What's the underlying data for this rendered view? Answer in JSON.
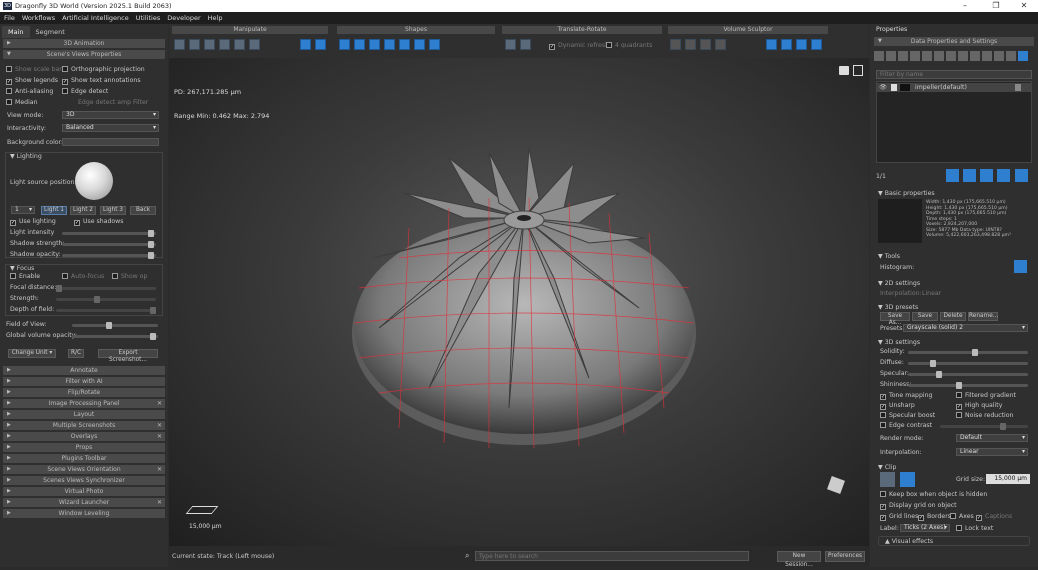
{
  "app": {
    "title": "Dragonfly 3D World (Version 2025.1 Build 2063)",
    "logo": "3D",
    "window_controls": [
      "–",
      "❐",
      "✕"
    ]
  },
  "menu": [
    "File",
    "Workflows",
    "Artificial Intelligence",
    "Utilities",
    "Developer",
    "Help"
  ],
  "left": {
    "tabs": [
      "Main",
      "Segment"
    ],
    "sections_top": [
      "3D Animation",
      "Scene's Views Properties"
    ],
    "views": {
      "show_scale_bar": "Show scale bar",
      "orthographic": "Orthographic projection",
      "show_legends": "Show legends",
      "show_text_annotations": "Show text annotations",
      "anti_aliasing": "Anti-aliasing",
      "edge_detect": "Edge detect",
      "median": "Median",
      "edge_detect_amp": "Edge detect amp Filter",
      "view_mode_label": "View mode:",
      "view_mode": "3D",
      "interactivity_label": "Interactivity:",
      "interactivity": "Balanced",
      "bg_color_label": "Background color:"
    },
    "lighting": {
      "header": "Lighting",
      "source_label": "Light source position:",
      "light_num": "1",
      "light_tabs": [
        "Light 1",
        "Light 2",
        "Light 3",
        "Back"
      ],
      "use_lighting": "Use lighting",
      "use_shadows": "Use shadows",
      "intensity": "Light intensity",
      "shadow_strength": "Shadow strength:",
      "shadow_opacity": "Shadow opacity:"
    },
    "focus": {
      "header": "Focus",
      "enable": "Enable",
      "auto_focus": "Auto-focus",
      "show_op": "Show op",
      "focal_distance": "Focal distance:",
      "strength": "Strength:",
      "depth_of_field": "Depth of field:"
    },
    "fov": "Field of View:",
    "gvo": "Global volume opacity:",
    "change_unit": "Change Unit",
    "rc": "R/C",
    "export_screenshot": "Export Screenshot...",
    "sections_bottom": [
      "Annotate",
      "Filter with AI",
      "Flip/Rotate",
      "Image Processing Panel",
      "Layout",
      "Multiple Screenshots",
      "Overlays",
      "Props",
      "Plugins Toolbar",
      "Scene Views Orientation",
      "Scenes Views Synchronizer",
      "Virtual Photo",
      "Wizard Launcher",
      "Window Leveling"
    ]
  },
  "toolbar": {
    "groups": [
      "Manipulate",
      "Shapes",
      "Translate-Rotate",
      "Volume Sculptor"
    ],
    "dynamic_refresh": "Dynamic refresh",
    "quadrants": "4 quadrants"
  },
  "viewport": {
    "pd": "PD: 267,171.285 µm",
    "range": "Range Min: 0.462 Max: 2.794",
    "scale": "15,000 µm"
  },
  "status": {
    "state": "Current state: Track (Left mouse)",
    "search_placeholder": "Type here to search",
    "new_session": "New Session...",
    "preferences": "Preferences"
  },
  "right": {
    "props_tab": "Properties",
    "data_props": "Data Properties and Settings",
    "filter_placeholder": "Filter by name",
    "item_name": "impeller(default)",
    "page": "1/1",
    "basic": {
      "header": "Basic properties",
      "lines": [
        "Width: 1,430 px (175,665.510 µm)",
        "Height: 1,430 px (175,665.510 µm)",
        "Depth: 1,430 px (175,665.510 µm)",
        "Time steps: 1",
        "Voxels: 2,924,207,000",
        "Size: 5877 Mb  Data type: UINT8?",
        "Volume: 5,422,603,263,498.828 µm³"
      ]
    },
    "tools": "Tools",
    "histogram": "Histogram:",
    "settings2d": "2D settings",
    "interpolation2d_label": "Interpolation:",
    "interpolation2d": "Linear",
    "presets3d": "3D presets",
    "preset_buttons": [
      "Save As...",
      "Save",
      "Delete",
      "Rename..."
    ],
    "presets_label": "Presets:",
    "presets_value": "Grayscale (solid) 2",
    "settings3d": "3D settings",
    "solidity": "Solidity:",
    "diffuse": "Diffuse:",
    "specular": "Specular:",
    "shininess": "Shininess:",
    "tone_mapping": "Tone mapping",
    "filtered_gradient": "Filtered gradient",
    "unsharp": "Unsharp",
    "high_quality": "High quality",
    "specular_boost": "Specular boost",
    "noise_reduction": "Noise reduction",
    "edge_contrast": "Edge contrast",
    "render_mode_label": "Render mode:",
    "render_mode": "Default",
    "interpolation_label": "Interpolation:",
    "interpolation": "Linear",
    "clip": "Clip",
    "grid_size_label": "Grid size:",
    "grid_size": "15,000 µm",
    "keep_box": "Keep box when object is hidden",
    "display_grid": "Display grid on object",
    "grid_lines": "Grid lines",
    "borders": "Borders",
    "axes": "Axes",
    "captions": "Captions",
    "label_label": "Label:",
    "label_value": "Ticks (2 Axes)",
    "lock_text": "Lock text",
    "visual_effects": "Visual effects"
  },
  "colors": {
    "accent": "#2f7fd0",
    "grid": "#e0303a",
    "panel": "#2f2f2f"
  }
}
